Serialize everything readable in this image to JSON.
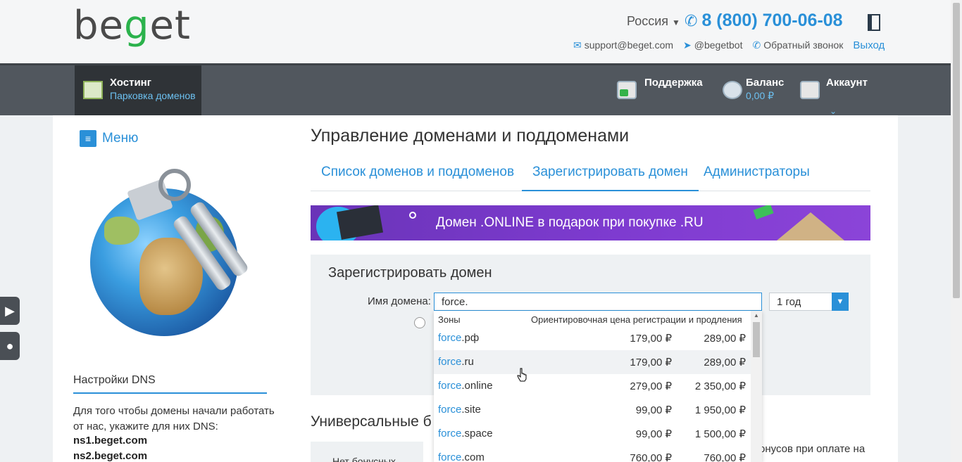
{
  "header": {
    "logo_text": "beget",
    "region": "Россия",
    "phone": "8 (800) 700-06-08",
    "email": "support@beget.com",
    "telegram": "@begetbot",
    "callback": "Обратный звонок",
    "logout": "Выход"
  },
  "nav": {
    "hosting_title": "Хостинг",
    "hosting_sub": "Парковка доменов",
    "support": "Поддержка",
    "balance_label": "Баланс",
    "balance_value": "0,00 ₽",
    "account": "Аккаунт"
  },
  "sidebar": {
    "menu_label": "Меню",
    "dns_title": "Настройки DNS",
    "dns_text": "Для того чтобы домены начали работать от нас, укажите для них DNS:",
    "ns1": "ns1.beget.com",
    "ns2": "ns2.beget.com"
  },
  "main": {
    "title": "Управление доменами и поддоменами",
    "tabs": [
      {
        "label": "Список доменов и поддоменов"
      },
      {
        "label": "Зарегистрировать домен"
      },
      {
        "label": "Администраторы"
      }
    ],
    "banner_text": "Домен .ONLINE в подарок при покупке .RU",
    "register": {
      "title": "Зарегистрировать домен",
      "name_label": "Имя домена:",
      "input_value": "force.",
      "period": "1 год"
    },
    "dropdown": {
      "col_zones": "Зоны",
      "col_price": "Ориентировочная цена регистрации и продления",
      "rows": [
        {
          "name": "force",
          "zone": ".рф",
          "reg": "179,00 ₽",
          "renew": "289,00 ₽"
        },
        {
          "name": "force",
          "zone": ".ru",
          "reg": "179,00 ₽",
          "renew": "289,00 ₽"
        },
        {
          "name": "force",
          "zone": ".online",
          "reg": "279,00 ₽",
          "renew": "2 350,00 ₽"
        },
        {
          "name": "force",
          "zone": ".site",
          "reg": "99,00 ₽",
          "renew": "1 950,00 ₽"
        },
        {
          "name": "force",
          "zone": ".space",
          "reg": "99,00 ₽",
          "renew": "1 500,00 ₽"
        },
        {
          "name": "force",
          "zone": ".com",
          "reg": "760,00 ₽",
          "renew": "760,00 ₽"
        }
      ]
    },
    "universal_title": "Универсальные б",
    "no_bonus": "Нет бонусных",
    "bonus_text": "онусов при оплате на"
  },
  "colors": {
    "accent": "#2a90d8",
    "navbar": "#51575e",
    "banner": "#7e3bd0",
    "logo_green": "#2bb24c"
  }
}
